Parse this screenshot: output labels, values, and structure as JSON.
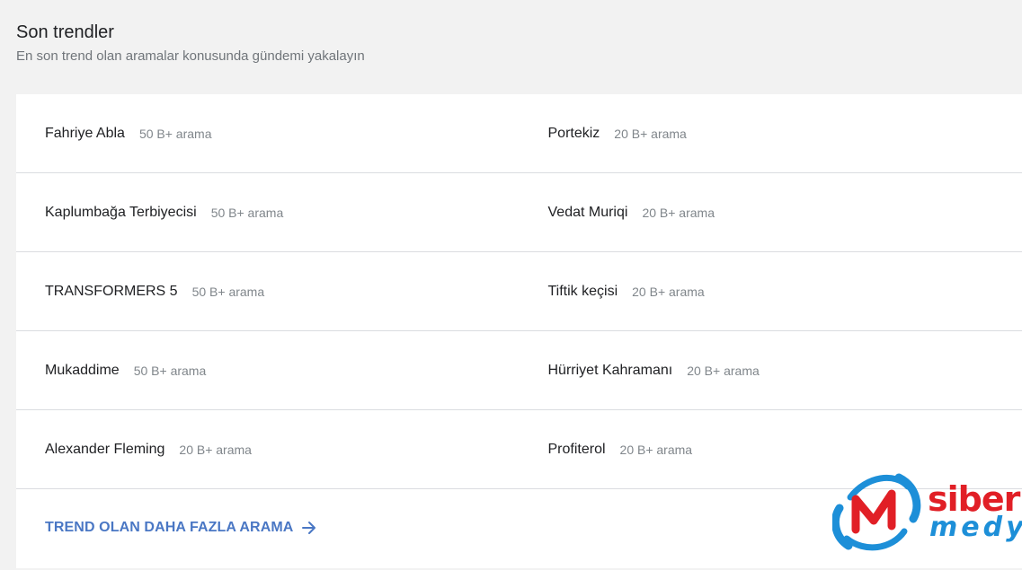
{
  "header": {
    "title": "Son trendler",
    "subtitle": "En son trend olan aramalar konusunda gündemi yakalayın"
  },
  "trends": [
    [
      {
        "term": "Fahriye Abla",
        "count": "50 B+ arama"
      },
      {
        "term": "Portekiz",
        "count": "20 B+ arama"
      }
    ],
    [
      {
        "term": "Kaplumbağa Terbiyecisi",
        "count": "50 B+ arama"
      },
      {
        "term": "Vedat Muriqi",
        "count": "20 B+ arama"
      }
    ],
    [
      {
        "term": "TRANSFORMERS 5",
        "count": "50 B+ arama"
      },
      {
        "term": "Tiftik keçisi",
        "count": "20 B+ arama"
      }
    ],
    [
      {
        "term": "Mukaddime",
        "count": "50 B+ arama"
      },
      {
        "term": "Hürriyet Kahramanı",
        "count": "20 B+ arama"
      }
    ],
    [
      {
        "term": "Alexander Fleming",
        "count": "20 B+ arama"
      },
      {
        "term": "Profiterol",
        "count": "20 B+ arama"
      }
    ]
  ],
  "more_link": {
    "label": "TREND OLAN DAHA FAZLA ARAMA",
    "icon": "arrow-right-icon"
  },
  "watermark": {
    "line1": "siber",
    "line2": "medya"
  },
  "colors": {
    "link": "#4a77c4",
    "watermark_red": "#e11f26",
    "watermark_blue": "#1d8fd8"
  }
}
